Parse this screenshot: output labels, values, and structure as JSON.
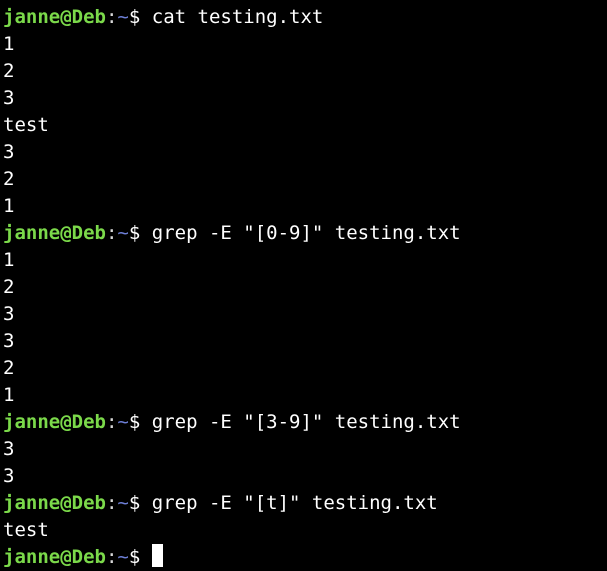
{
  "prompt": {
    "user_host": "janne@Deb",
    "separator": ":",
    "path": "~",
    "symbol": "$"
  },
  "session": [
    {
      "command": "cat testing.txt",
      "output": [
        "1",
        "2",
        "3",
        "test",
        "3",
        "2",
        "1"
      ]
    },
    {
      "command": "grep -E \"[0-9]\" testing.txt",
      "output": [
        "1",
        "2",
        "3",
        "3",
        "2",
        "1"
      ]
    },
    {
      "command": "grep -E \"[3-9]\" testing.txt",
      "output": [
        "3",
        "3"
      ]
    },
    {
      "command": "grep -E \"[t]\" testing.txt",
      "output": [
        "test"
      ]
    }
  ],
  "colors": {
    "background": "#000000",
    "user_host": "#7bd94a",
    "path": "#6e7fd6",
    "text": "#ffffff"
  }
}
